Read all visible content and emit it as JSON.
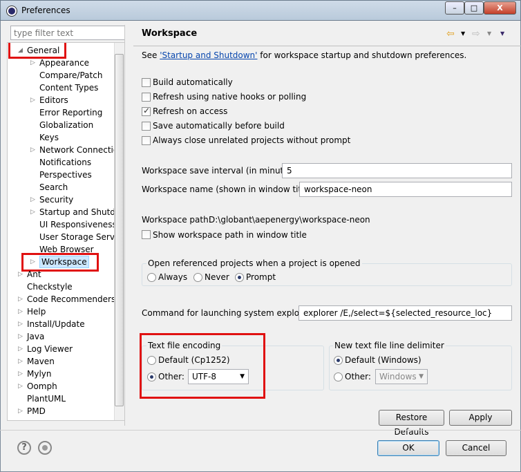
{
  "window": {
    "title": "Preferences",
    "minimize": "–",
    "maximize": "□",
    "close": "X"
  },
  "filter": {
    "placeholder": "type filter text"
  },
  "tree": [
    {
      "label": "General",
      "level": 0,
      "expanded": true,
      "highlight": true
    },
    {
      "label": "Appearance",
      "level": 1,
      "expandable": true
    },
    {
      "label": "Compare/Patch",
      "level": 1
    },
    {
      "label": "Content Types",
      "level": 1
    },
    {
      "label": "Editors",
      "level": 1,
      "expandable": true
    },
    {
      "label": "Error Reporting",
      "level": 1
    },
    {
      "label": "Globalization",
      "level": 1
    },
    {
      "label": "Keys",
      "level": 1
    },
    {
      "label": "Network Connections",
      "level": 1,
      "expandable": true
    },
    {
      "label": "Notifications",
      "level": 1
    },
    {
      "label": "Perspectives",
      "level": 1
    },
    {
      "label": "Search",
      "level": 1
    },
    {
      "label": "Security",
      "level": 1,
      "expandable": true
    },
    {
      "label": "Startup and Shutdown",
      "level": 1,
      "expandable": true
    },
    {
      "label": "UI Responsiveness Monitoring",
      "level": 1
    },
    {
      "label": "User Storage Service",
      "level": 1
    },
    {
      "label": "Web Browser",
      "level": 1
    },
    {
      "label": "Workspace",
      "level": 1,
      "expandable": true,
      "selected": true,
      "highlight": true
    },
    {
      "label": "Ant",
      "level": 0,
      "expandable": true
    },
    {
      "label": "Checkstyle",
      "level": 0
    },
    {
      "label": "Code Recommenders",
      "level": 0,
      "expandable": true
    },
    {
      "label": "Help",
      "level": 0,
      "expandable": true
    },
    {
      "label": "Install/Update",
      "level": 0,
      "expandable": true
    },
    {
      "label": "Java",
      "level": 0,
      "expandable": true
    },
    {
      "label": "Log Viewer",
      "level": 0,
      "expandable": true
    },
    {
      "label": "Maven",
      "level": 0,
      "expandable": true
    },
    {
      "label": "Mylyn",
      "level": 0,
      "expandable": true
    },
    {
      "label": "Oomph",
      "level": 0,
      "expandable": true
    },
    {
      "label": "PlantUML",
      "level": 0
    },
    {
      "label": "PMD",
      "level": 0,
      "expandable": true
    }
  ],
  "page": {
    "title": "Workspace",
    "intro_prefix": "See ",
    "intro_link": "'Startup and Shutdown'",
    "intro_suffix": " for workspace startup and shutdown preferences.",
    "checkboxes": [
      {
        "label": "Build automatically",
        "checked": false
      },
      {
        "label": "Refresh using native hooks or polling",
        "checked": false
      },
      {
        "label": "Refresh on access",
        "checked": true
      },
      {
        "label": "Save automatically before build",
        "checked": false
      },
      {
        "label": "Always close unrelated projects without prompt",
        "checked": false
      }
    ],
    "save_interval_label": "Workspace save interval (in minutes):",
    "save_interval_value": "5",
    "name_label": "Workspace name (shown in window title):",
    "name_value": "workspace-neon",
    "path_label": "Workspace path:",
    "path_value": "D:\\globant\\aepenergy\\workspace-neon",
    "show_path_label": "Show workspace path in window title",
    "show_path_checked": false,
    "open_ref_label": "Open referenced projects when a project is opened",
    "open_ref_options": [
      {
        "label": "Always",
        "checked": false
      },
      {
        "label": "Never",
        "checked": false
      },
      {
        "label": "Prompt",
        "checked": true
      }
    ],
    "explorer_label": "Command for launching system explorer:",
    "explorer_value": "explorer /E,/select=${selected_resource_loc}",
    "encoding": {
      "title": "Text file encoding",
      "default_label": "Default (Cp1252)",
      "other_label": "Other:",
      "other_value": "UTF-8",
      "selected": "other"
    },
    "delimiter": {
      "title": "New text file line delimiter",
      "default_label": "Default (Windows)",
      "other_label": "Other:",
      "other_value": "Windows",
      "selected": "default"
    },
    "restore_defaults": "Restore Defaults",
    "apply": "Apply"
  },
  "footer": {
    "help_icon": "?",
    "ok": "OK",
    "cancel": "Cancel"
  },
  "colors": {
    "highlight_box": "#e01010",
    "selection": "#cce8ff"
  }
}
